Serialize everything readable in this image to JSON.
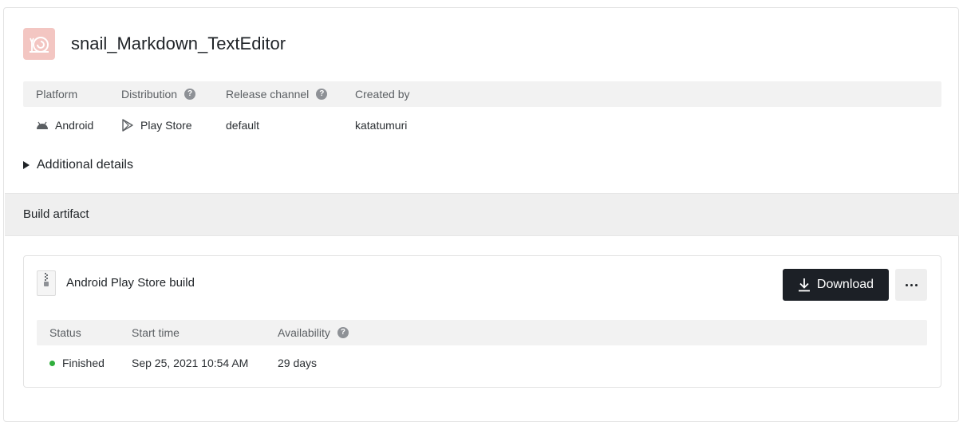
{
  "app": {
    "title": "snail_Markdown_TextEditor",
    "icon": "snail-icon"
  },
  "meta": {
    "headers": {
      "platform": "Platform",
      "distribution": "Distribution",
      "release_channel": "Release channel",
      "created_by": "Created by"
    },
    "values": {
      "platform": "Android",
      "distribution": "Play Store",
      "release_channel": "default",
      "created_by": "katatumuri"
    },
    "help_glyph": "?"
  },
  "details": {
    "label": "Additional details"
  },
  "build_artifact_section": {
    "title": "Build artifact"
  },
  "artifact": {
    "name": "Android Play Store build",
    "download_label": "Download",
    "headers": {
      "status": "Status",
      "start_time": "Start time",
      "availability": "Availability"
    },
    "values": {
      "status": "Finished",
      "start_time": "Sep 25, 2021 10:54 AM",
      "availability": "29 days"
    }
  },
  "colors": {
    "status_finished": "#2fae3c",
    "download_button": "#1c2026",
    "app_icon_bg": "#f3c6c2"
  }
}
